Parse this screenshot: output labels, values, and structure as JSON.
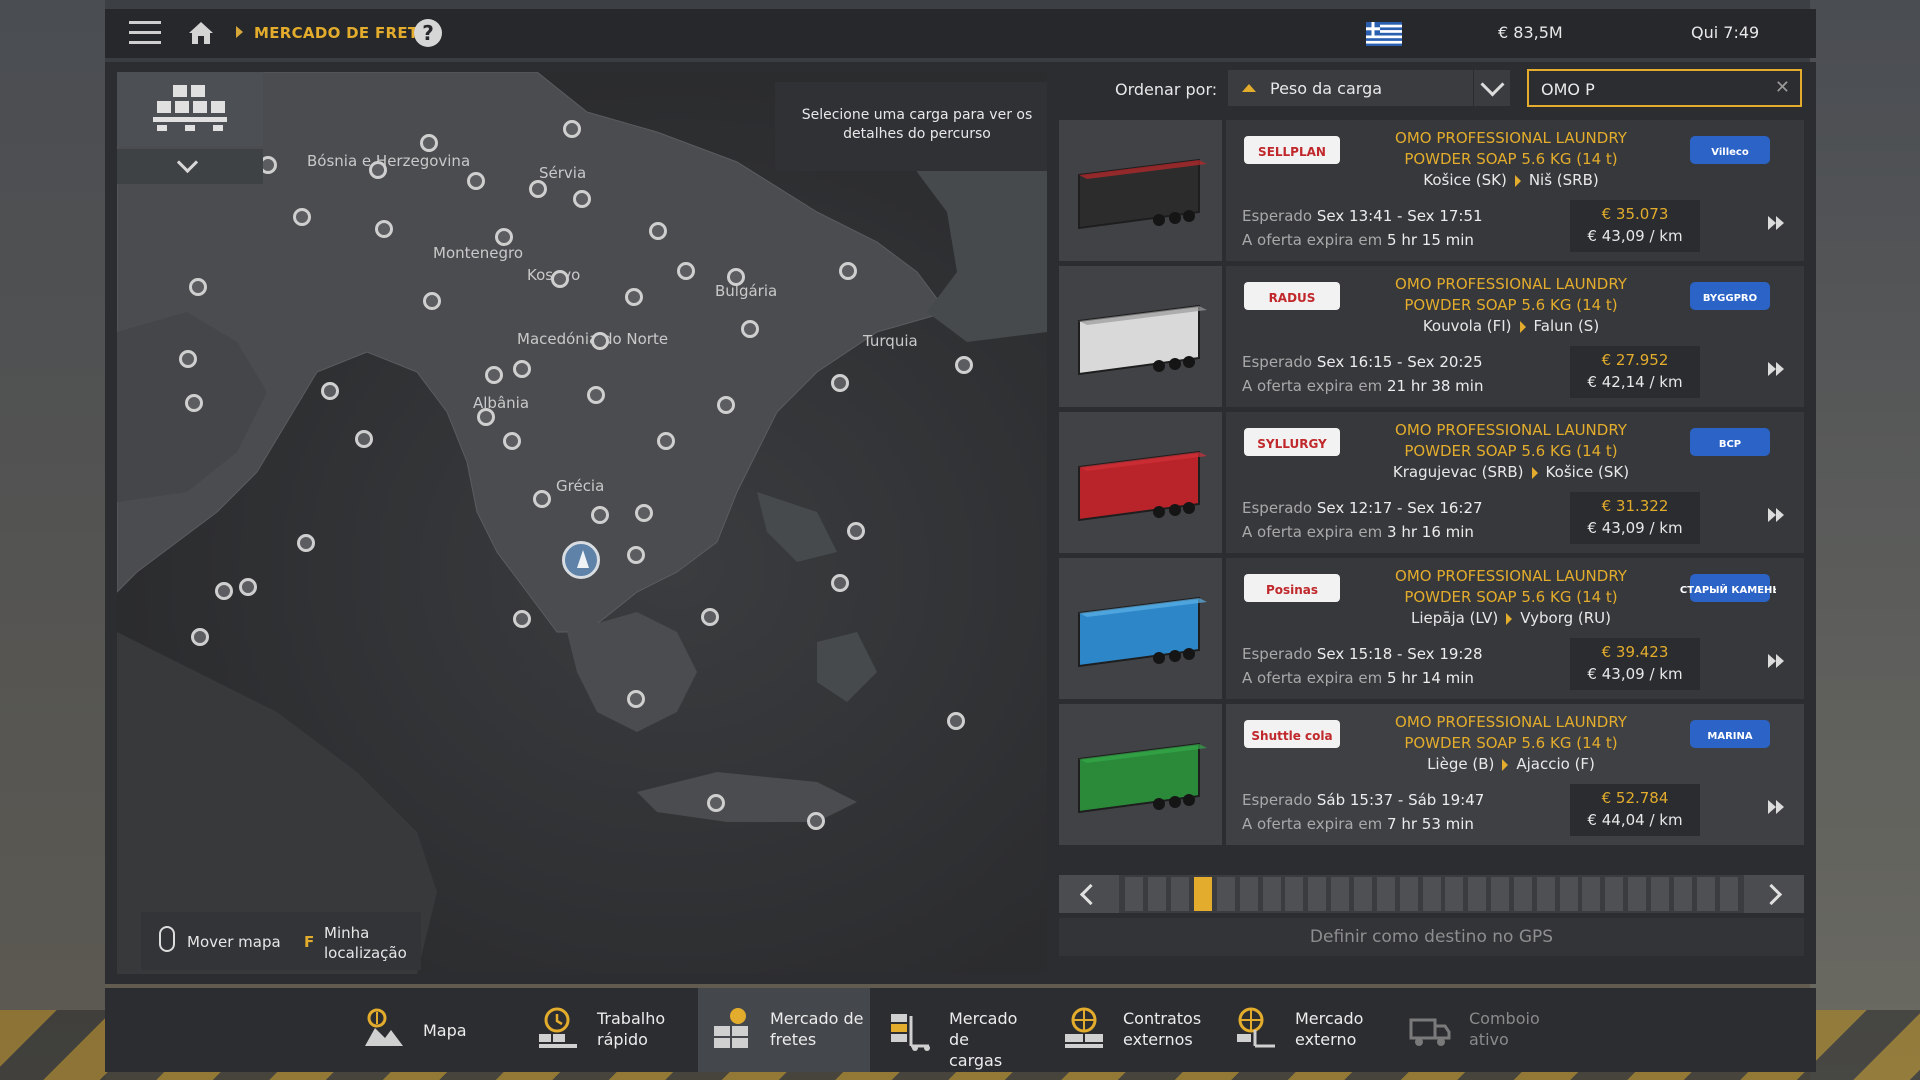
{
  "topbar": {
    "breadcrumb": "MERCADO DE FRETES",
    "help": "?",
    "money": "€ 83,5M",
    "clock": "Qui 7:49"
  },
  "map": {
    "hint": "Selecione uma carga para ver os detalhes do percurso",
    "labels": [
      {
        "text": "Bósnia e Herzegovina"
      },
      {
        "text": "Sérvia"
      },
      {
        "text": "Montenegro"
      },
      {
        "text": "Kosovo"
      },
      {
        "text": "Bulgária"
      },
      {
        "text": "Macedónia do Norte"
      },
      {
        "text": "Turquia"
      },
      {
        "text": "Albânia"
      },
      {
        "text": "Grécia"
      }
    ],
    "legend": {
      "move_label": "Mover mapa",
      "key": "F",
      "location_label": "Minha localização"
    }
  },
  "sort": {
    "label": "Ordenar por:",
    "value": "Peso da carga"
  },
  "search": {
    "value": "OMO P",
    "clear": "✕"
  },
  "offers": [
    {
      "company": "SELLPLAN",
      "partner": "Villeco",
      "cargo_line1": "OMO PROFESSIONAL LAUNDRY",
      "cargo_line2": "POWDER SOAP 5.6 KG (14 t)",
      "from": "Košice (SK)",
      "to": "Niš (SRB)",
      "expected_label": "Esperado",
      "expected": "Sex 13:41 - Sex 17:51",
      "expires_label": "A oferta expira em",
      "expires": "5 hr 15 min",
      "price": "€ 35.073",
      "per_km": "€ 43,09 / km",
      "trailer_color": "#2c2c2c",
      "accent": "#c0282b"
    },
    {
      "company": "RADUS",
      "partner": "BYGGPRO",
      "cargo_line1": "OMO PROFESSIONAL LAUNDRY",
      "cargo_line2": "POWDER SOAP 5.6 KG (14 t)",
      "from": "Kouvola (FI)",
      "to": "Falun (S)",
      "expected_label": "Esperado",
      "expected": "Sex 16:15 - Sex 20:25",
      "expires_label": "A oferta expira em",
      "expires": "21 hr 38 min",
      "price": "€ 27.952",
      "per_km": "€ 42,14 / km",
      "trailer_color": "#d9d9d9",
      "accent": "#9a9a9a"
    },
    {
      "company": "SYLLURGY",
      "partner": "BCP",
      "cargo_line1": "OMO PROFESSIONAL LAUNDRY",
      "cargo_line2": "POWDER SOAP 5.6 KG (14 t)",
      "from": "Kragujevac (SRB)",
      "to": "Košice (SK)",
      "expected_label": "Esperado",
      "expected": "Sex 12:17 - Sex 16:27",
      "expires_label": "A oferta expira em",
      "expires": "3 hr 16 min",
      "price": "€ 31.322",
      "per_km": "€ 43,09 / km",
      "trailer_color": "#b8242a",
      "accent": "#d03038"
    },
    {
      "company": "Posinas",
      "partner": "СТАРЫЙ КАМЕНЬ",
      "cargo_line1": "OMO PROFESSIONAL LAUNDRY",
      "cargo_line2": "POWDER SOAP 5.6 KG (14 t)",
      "from": "Liepāja (LV)",
      "to": "Vyborg (RU)",
      "expected_label": "Esperado",
      "expected": "Sex 15:18 - Sex 19:28",
      "expires_label": "A oferta expira em",
      "expires": "5 hr 14 min",
      "price": "€ 39.423",
      "per_km": "€ 43,09 / km",
      "trailer_color": "#2c86c8",
      "accent": "#5cb0e6"
    },
    {
      "company": "Shuttle cola",
      "partner": "MARINA",
      "cargo_line1": "OMO PROFESSIONAL LAUNDRY",
      "cargo_line2": "POWDER SOAP 5.6 KG (14 t)",
      "from": "Liège (B)",
      "to": "Ajaccio (F)",
      "expected_label": "Esperado",
      "expected": "Sáb 15:37 - Sáb 19:47",
      "expires_label": "A oferta expira em",
      "expires": "7 hr 53 min",
      "price": "€ 52.784",
      "per_km": "€ 44,04 / km",
      "trailer_color": "#2b8a3a",
      "accent": "#34a848"
    }
  ],
  "pager": {
    "pages": 27,
    "current": 4
  },
  "gps_button": "Definir como destino no GPS",
  "nav": [
    {
      "line1": "Mapa",
      "line2": "",
      "icon": "map-icon"
    },
    {
      "line1": "Trabalho",
      "line2": "rápido",
      "icon": "quick-job-icon"
    },
    {
      "line1": "Mercado de",
      "line2": "fretes",
      "icon": "freight-market-icon",
      "active": true
    },
    {
      "line1": "Mercado de",
      "line2": "cargas",
      "icon": "cargo-market-icon"
    },
    {
      "line1": "Contratos",
      "line2": "externos",
      "icon": "external-contracts-icon"
    },
    {
      "line1": "Mercado",
      "line2": "externo",
      "icon": "external-market-icon"
    },
    {
      "line1": "Comboio",
      "line2": "ativo",
      "icon": "active-convoy-icon",
      "dim": true
    }
  ],
  "colors": {
    "accent": "#e3ac2c",
    "panel": "#2b2d30",
    "row": "#36383b"
  }
}
